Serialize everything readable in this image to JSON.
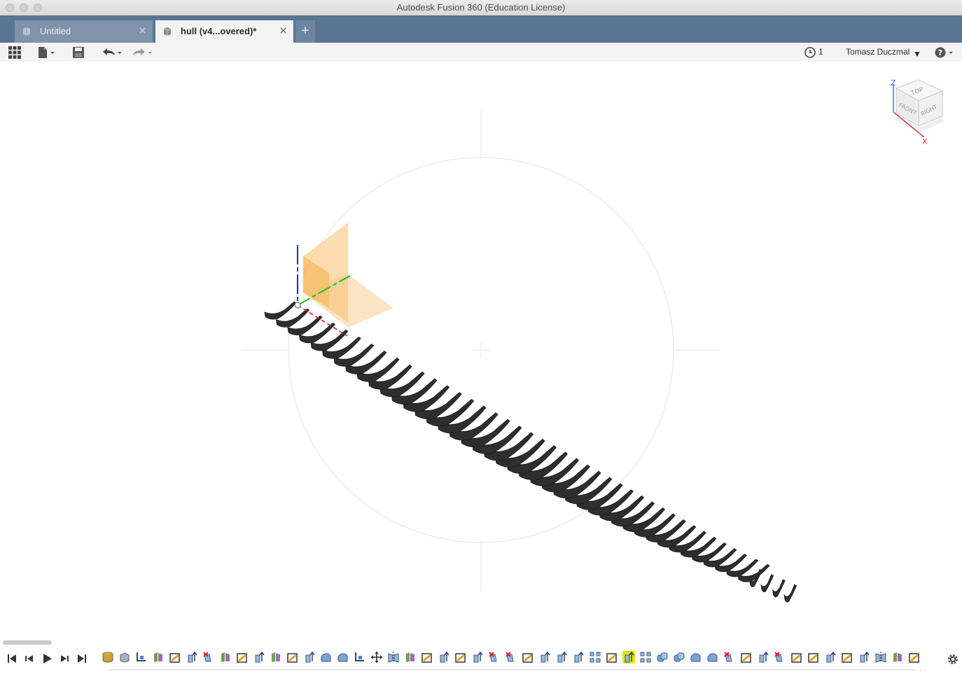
{
  "window": {
    "title": "Autodesk Fusion 360 (Education License)"
  },
  "tabs": [
    {
      "label": "Untitled",
      "active": false
    },
    {
      "label": "hull (v4...overed)*",
      "active": true
    }
  ],
  "toolbar": {
    "job_count": "1",
    "user_name": "Tomasz Duczmal"
  },
  "viewcube": {
    "faces": {
      "top": "TOP",
      "front": "FRONT",
      "right": "RIGHT"
    },
    "axes": {
      "z": "Z",
      "x": "X"
    }
  },
  "timeline": {
    "feature_icons": [
      "cylinder",
      "box",
      "sketch",
      "body",
      "plane",
      "extrude",
      "split",
      "body",
      "plane",
      "extrude",
      "body",
      "plane",
      "extrude",
      "shell",
      "shell",
      "sketch",
      "move",
      "mirror",
      "body",
      "plane",
      "extrude",
      "plane",
      "extrude",
      "split",
      "split",
      "plane",
      "extrude",
      "extrude",
      "extrude",
      "pattern",
      "plane",
      "extrude",
      "pattern",
      "combine",
      "combine",
      "shell",
      "shell",
      "split",
      "plane",
      "extrude",
      "split",
      "plane",
      "plane",
      "extrude",
      "plane",
      "extrude",
      "mirror",
      "body",
      "plane"
    ],
    "selected_index": 31
  },
  "colors": {
    "tab_bar": "#5a7592",
    "accent_selected": "#e6e200",
    "construction_plane": "#f6b24c",
    "hull_sections": "#2e2e2e"
  }
}
